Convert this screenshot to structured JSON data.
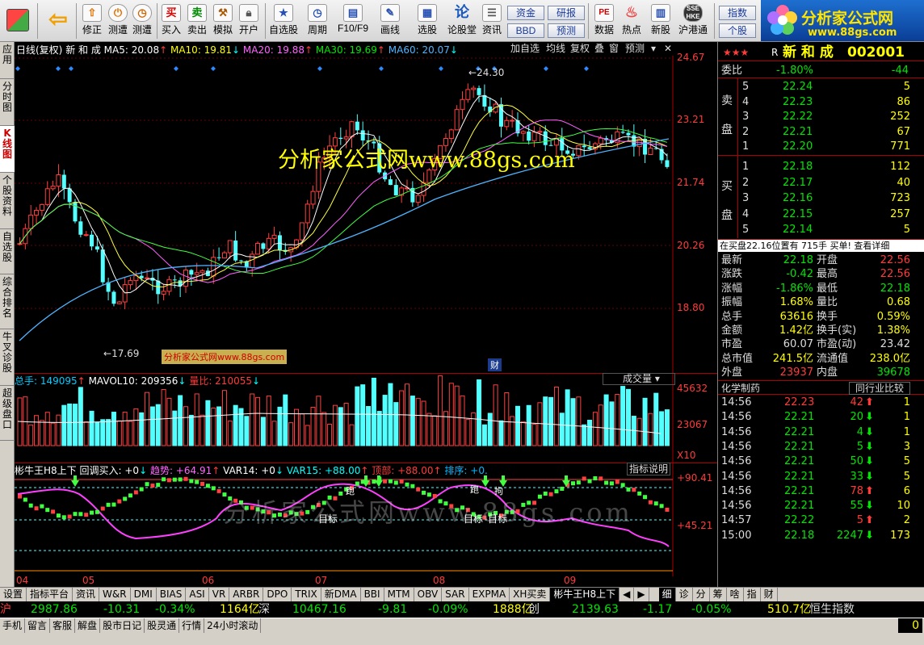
{
  "toolbar": {
    "buttons": [
      {
        "label": "修正",
        "icon": "up-arrow-icon"
      },
      {
        "label": "测遭",
        "icon": "clock-icon"
      },
      {
        "label": "买入",
        "icon": "buy-icon"
      },
      {
        "label": "卖出",
        "icon": "sell-icon"
      },
      {
        "label": "模拟",
        "icon": "hammer-icon"
      },
      {
        "label": "开户",
        "icon": "lock-icon"
      },
      {
        "label": "自选股",
        "icon": "star-icon"
      },
      {
        "label": "周期",
        "icon": "clock-icon"
      },
      {
        "label": "F10/F9",
        "icon": "f10-icon"
      },
      {
        "label": "画线",
        "icon": "pen-icon"
      },
      {
        "label": "选股",
        "icon": "screen-icon"
      },
      {
        "label": "论股堂",
        "icon": "chat-icon"
      },
      {
        "label": "资讯",
        "icon": "news-icon"
      },
      {
        "label": "数据",
        "icon": "pe-icon"
      },
      {
        "label": "热点",
        "icon": "fire-icon"
      },
      {
        "label": "新股",
        "icon": "new-icon"
      },
      {
        "label": "沪港通",
        "icon": "sse-hkex-icon"
      }
    ],
    "small_buttons": [
      "资金",
      "BBD",
      "研报",
      "预测",
      "指数",
      "个股"
    ],
    "logo_title": "分析家公式网",
    "logo_url": "www.88gs.com"
  },
  "left_tabs": [
    "应用",
    "分时图",
    "K线图",
    "个股资料",
    "自选股",
    "综合排名",
    "牛叉诊股",
    "超级盘口"
  ],
  "chart": {
    "header": {
      "period": "日线(复权)",
      "name": "新 和 成",
      "ma5": "MA5: 20.08",
      "ma10": "MA10: 19.81",
      "ma20": "MA20: 19.88",
      "ma30": "MA30: 19.69",
      "ma60": "MA60: 20.07"
    },
    "top_buttons": [
      "加自选",
      "均线",
      "复权",
      "叠",
      "窗",
      "预测"
    ],
    "price_ticks": [
      "24.67",
      "23.21",
      "21.74",
      "20.26",
      "18.80"
    ],
    "high_label": "24.30",
    "low_label": "17.69",
    "watermark": "分析家公式网www.88gs.com",
    "small_watermark": "分析家公式网www.88gs.com",
    "cai_label": "财",
    "volume": {
      "total": "总手: 149095",
      "mavol": "MAVOL10: 209356",
      "liangbi": "量比: 210055",
      "dropdown": "成交量",
      "ticks": [
        "45632",
        "23067"
      ],
      "unit": "X10"
    },
    "indicator": {
      "title": "彬牛王H8上下",
      "v1": "回调买入: +0",
      "v2": "趋势: +64.91",
      "v3": "VAR14: +0",
      "v4": "VAR15: +88.00",
      "v5": "顶部: +88.00",
      "v6": "排序: +0.",
      "help": "指标说明",
      "ticks": [
        "+90.41",
        "+45.21"
      ],
      "labels": [
        "目标",
        "目标",
        "目标",
        "跑",
        "跑",
        "拘"
      ],
      "watermark": "分析家公式网www.88gs.com"
    },
    "months": [
      "04",
      "05",
      "06",
      "07",
      "08",
      "09"
    ]
  },
  "right_panel": {
    "stars": "★★★",
    "r_mark": "R",
    "name": "新 和 成",
    "code": "002001",
    "weibi": {
      "label": "委比",
      "pct": "-1.80%",
      "val": "-44"
    },
    "sell": [
      {
        "n": "5",
        "p": "22.24",
        "v": "5"
      },
      {
        "n": "4",
        "p": "22.23",
        "v": "86"
      },
      {
        "n": "3",
        "p": "22.22",
        "v": "252"
      },
      {
        "n": "2",
        "p": "22.21",
        "v": "67"
      },
      {
        "n": "1",
        "p": "22.20",
        "v": "771"
      }
    ],
    "buy": [
      {
        "n": "1",
        "p": "22.18",
        "v": "112"
      },
      {
        "n": "2",
        "p": "22.17",
        "v": "40"
      },
      {
        "n": "3",
        "p": "22.16",
        "v": "723"
      },
      {
        "n": "4",
        "p": "22.15",
        "v": "257"
      },
      {
        "n": "5",
        "p": "22.14",
        "v": "5"
      }
    ],
    "sell_label": [
      "卖",
      "盘"
    ],
    "buy_label": [
      "买",
      "盘"
    ],
    "notice": "在买盘22.16位置有 715手 买单! 查看详细",
    "stats": [
      {
        "l1": "最新",
        "v1": "22.18",
        "l2": "开盘",
        "v2": "22.56"
      },
      {
        "l1": "涨跌",
        "v1": "-0.42",
        "l2": "最高",
        "v2": "22.56"
      },
      {
        "l1": "涨幅",
        "v1": "-1.86%",
        "l2": "最低",
        "v2": "22.18"
      },
      {
        "l1": "振幅",
        "v1": "1.68%",
        "l2": "量比",
        "v2": "0.68"
      },
      {
        "l1": "总手",
        "v1": "63616",
        "l2": "换手",
        "v2": "0.59%"
      },
      {
        "l1": "金额",
        "v1": "1.42亿",
        "l2": "换手(实)",
        "v2": "1.38%"
      },
      {
        "l1": "市盈",
        "v1": "60.07",
        "l2": "市盈(动)",
        "v2": "23.42"
      },
      {
        "l1": "总市值",
        "v1": "241.5亿",
        "l2": "流通值",
        "v2": "238.0亿"
      },
      {
        "l1": "外盘",
        "v1": "23937",
        "l2": "内盘",
        "v2": "39678"
      }
    ],
    "industry": "化学制药",
    "industry_btn": "同行业比较",
    "ticks": [
      {
        "t": "14:56",
        "p": "22.23",
        "v": "42",
        "dir": "up",
        "n": "1"
      },
      {
        "t": "14:56",
        "p": "22.21",
        "v": "20",
        "dir": "down",
        "n": "1"
      },
      {
        "t": "14:56",
        "p": "22.21",
        "v": "4",
        "dir": "down",
        "n": "1"
      },
      {
        "t": "14:56",
        "p": "22.21",
        "v": "5",
        "dir": "down",
        "n": "3"
      },
      {
        "t": "14:56",
        "p": "22.21",
        "v": "50",
        "dir": "down",
        "n": "5"
      },
      {
        "t": "14:56",
        "p": "22.21",
        "v": "33",
        "dir": "down",
        "n": "5"
      },
      {
        "t": "14:56",
        "p": "22.21",
        "v": "78",
        "dir": "up",
        "n": "6"
      },
      {
        "t": "14:56",
        "p": "22.21",
        "v": "55",
        "dir": "down",
        "n": "10"
      },
      {
        "t": "14:57",
        "p": "22.22",
        "v": "5",
        "dir": "up",
        "n": "2"
      },
      {
        "t": "15:00",
        "p": "22.18",
        "v": "2247",
        "dir": "down",
        "n": "173"
      }
    ]
  },
  "bottom_tabs": [
    "设置",
    "指标平台",
    "资讯",
    "W&R",
    "DMI",
    "BIAS",
    "ASI",
    "VR",
    "ARBR",
    "DPO",
    "TRIX",
    "新DMA",
    "BBI",
    "MTM",
    "OBV",
    "SAR",
    "EXPMA",
    "XH买卖",
    "彬牛王H8上下"
  ],
  "right_bottom_tabs": [
    "细",
    "诊",
    "分",
    "筹",
    "啥",
    "指",
    "财"
  ],
  "index_bar": {
    "hu": {
      "label": "沪",
      "v": "2987.86",
      "c": "-10.31",
      "p": "-0.34%",
      "amt": "1164亿"
    },
    "shen": {
      "label": "深",
      "v": "10467.16",
      "c": "-9.81",
      "p": "-0.09%",
      "amt": "1888亿"
    },
    "chuang": {
      "label": "创",
      "v": "2139.63",
      "c": "-1.17",
      "p": "-0.05%",
      "amt": "510.7亿"
    },
    "hs": "恒生指数"
  },
  "status_bar": [
    "手机",
    "留言",
    "客服",
    "解盘",
    "股市日记",
    "股灵通",
    "行情",
    "24小时滚动"
  ],
  "status_right": "0"
}
